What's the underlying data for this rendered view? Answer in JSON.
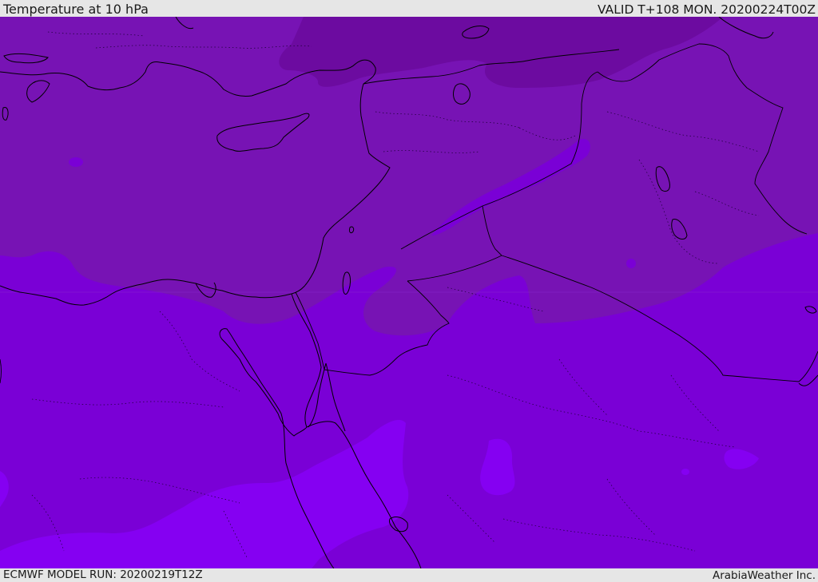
{
  "header": {
    "title": "Temperature at 10 hPa",
    "valid": "VALID T+108 MON. 20200224T00Z"
  },
  "footer": {
    "model_run": "ECMWF MODEL RUN: 20200219T12Z",
    "credit": "ArabiaWeather Inc."
  },
  "colors": {
    "background": "#e6e6e6",
    "warm_violet": "#7a00d6",
    "cool_violet": "#7713b4",
    "coldest_violet": "#6c0ba0",
    "lighter_violet": "#8500f2",
    "coastline": "#000000"
  }
}
